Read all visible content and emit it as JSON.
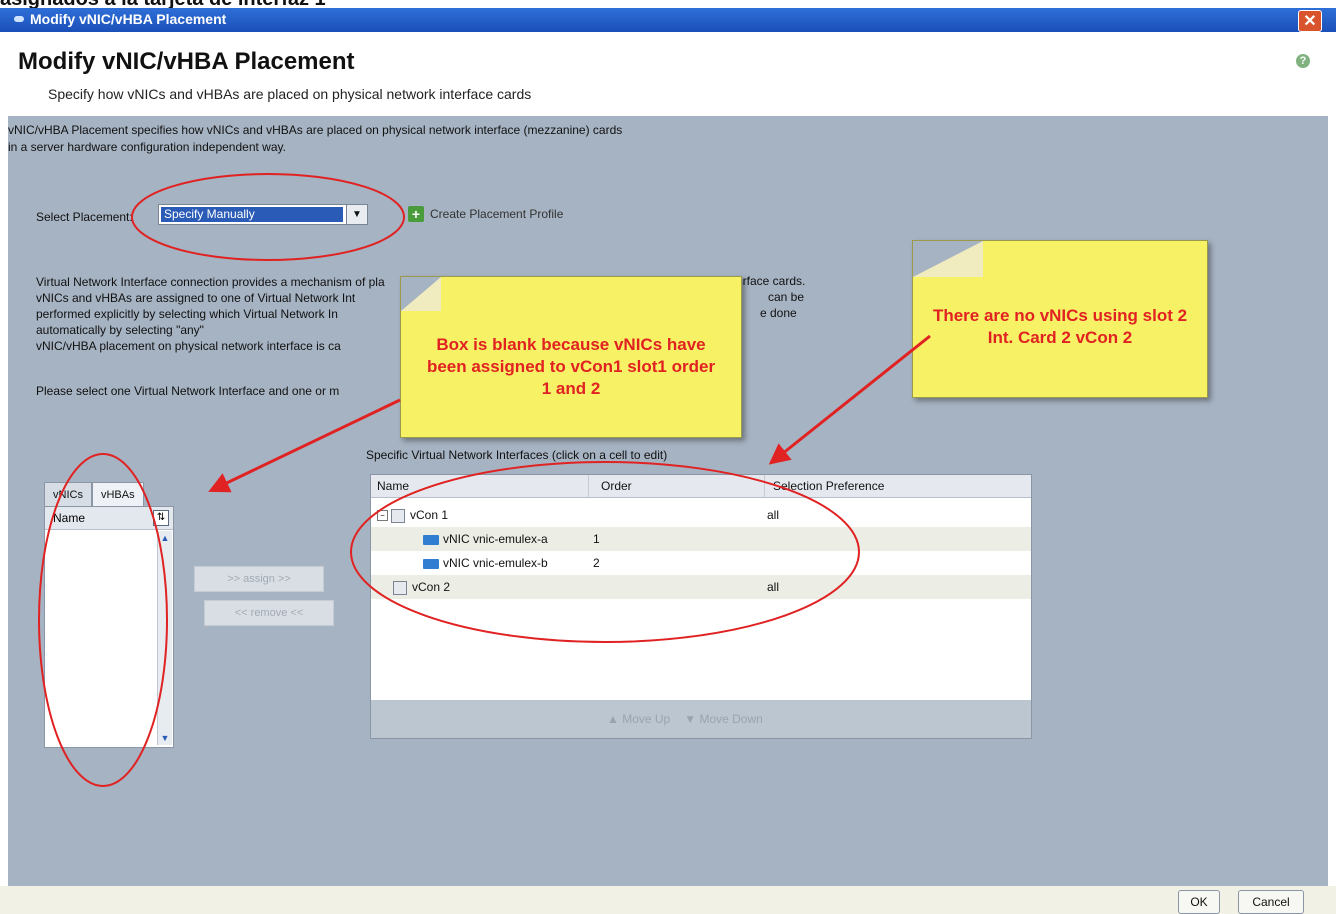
{
  "caption": "asignados a la tarjeta de interfaz 1",
  "window": {
    "title": "Modify vNIC/vHBA Placement",
    "close": "✕"
  },
  "header": {
    "title": "Modify vNIC/vHBA Placement",
    "subtitle": "Specify how vNICs and vHBAs are placed on physical network interface cards",
    "help": "?"
  },
  "description": [
    "vNIC/vHBA Placement specifies how vNICs and vHBAs are placed on physical network interface (mezzanine) cards",
    "in a server hardware configuration independent way."
  ],
  "placement": {
    "label": "Select Placement:",
    "value": "Specify Manually",
    "create_label": "Create Placement Profile"
  },
  "info": {
    "lines_left": [
      "Virtual Network Interface connection provides a mechanism of pla",
      "vNICs and vHBAs are assigned to one of Virtual Network Int",
      "performed explicitly by selecting which Virtual Network In",
      "automatically by selecting \"any\"",
      "vNIC/vHBA placement on physical network interface is ca"
    ],
    "right_1": "erface cards.",
    "right_2": "can be",
    "right_3": "e done",
    "please": "Please select one Virtual Network Interface and one or m"
  },
  "tabs": [
    {
      "label": "vNICs"
    },
    {
      "label": "vHBAs"
    }
  ],
  "left_list": {
    "header": "Name"
  },
  "buttons": {
    "assign": ">> assign >>",
    "remove": "<< remove <<"
  },
  "grid": {
    "label": "Specific Virtual Network Interfaces (click on a cell to edit)",
    "columns": [
      "Name",
      "Order",
      "Selection Preference"
    ],
    "rows": [
      {
        "name": "vCon 1",
        "order": "",
        "pref": "all"
      },
      {
        "name": "vNIC vnic-emulex-a",
        "order": "1",
        "pref": ""
      },
      {
        "name": "vNIC vnic-emulex-b",
        "order": "2",
        "pref": ""
      },
      {
        "name": "vCon 2",
        "order": "",
        "pref": "all"
      }
    ],
    "move_up": "▲ Move Up",
    "move_down": "▼ Move Down"
  },
  "notes": {
    "note1": "Box is blank because vNICs have been assigned to vCon1 slot1 order 1 and 2",
    "note2": "There are no vNICs using slot 2 Int. Card 2 vCon 2"
  },
  "footer": {
    "ok": "OK",
    "cancel": "Cancel"
  },
  "colors": {
    "annotation_red": "#e02222",
    "note_yellow": "#f7f165",
    "selected_blue": "#2a5bb6"
  }
}
